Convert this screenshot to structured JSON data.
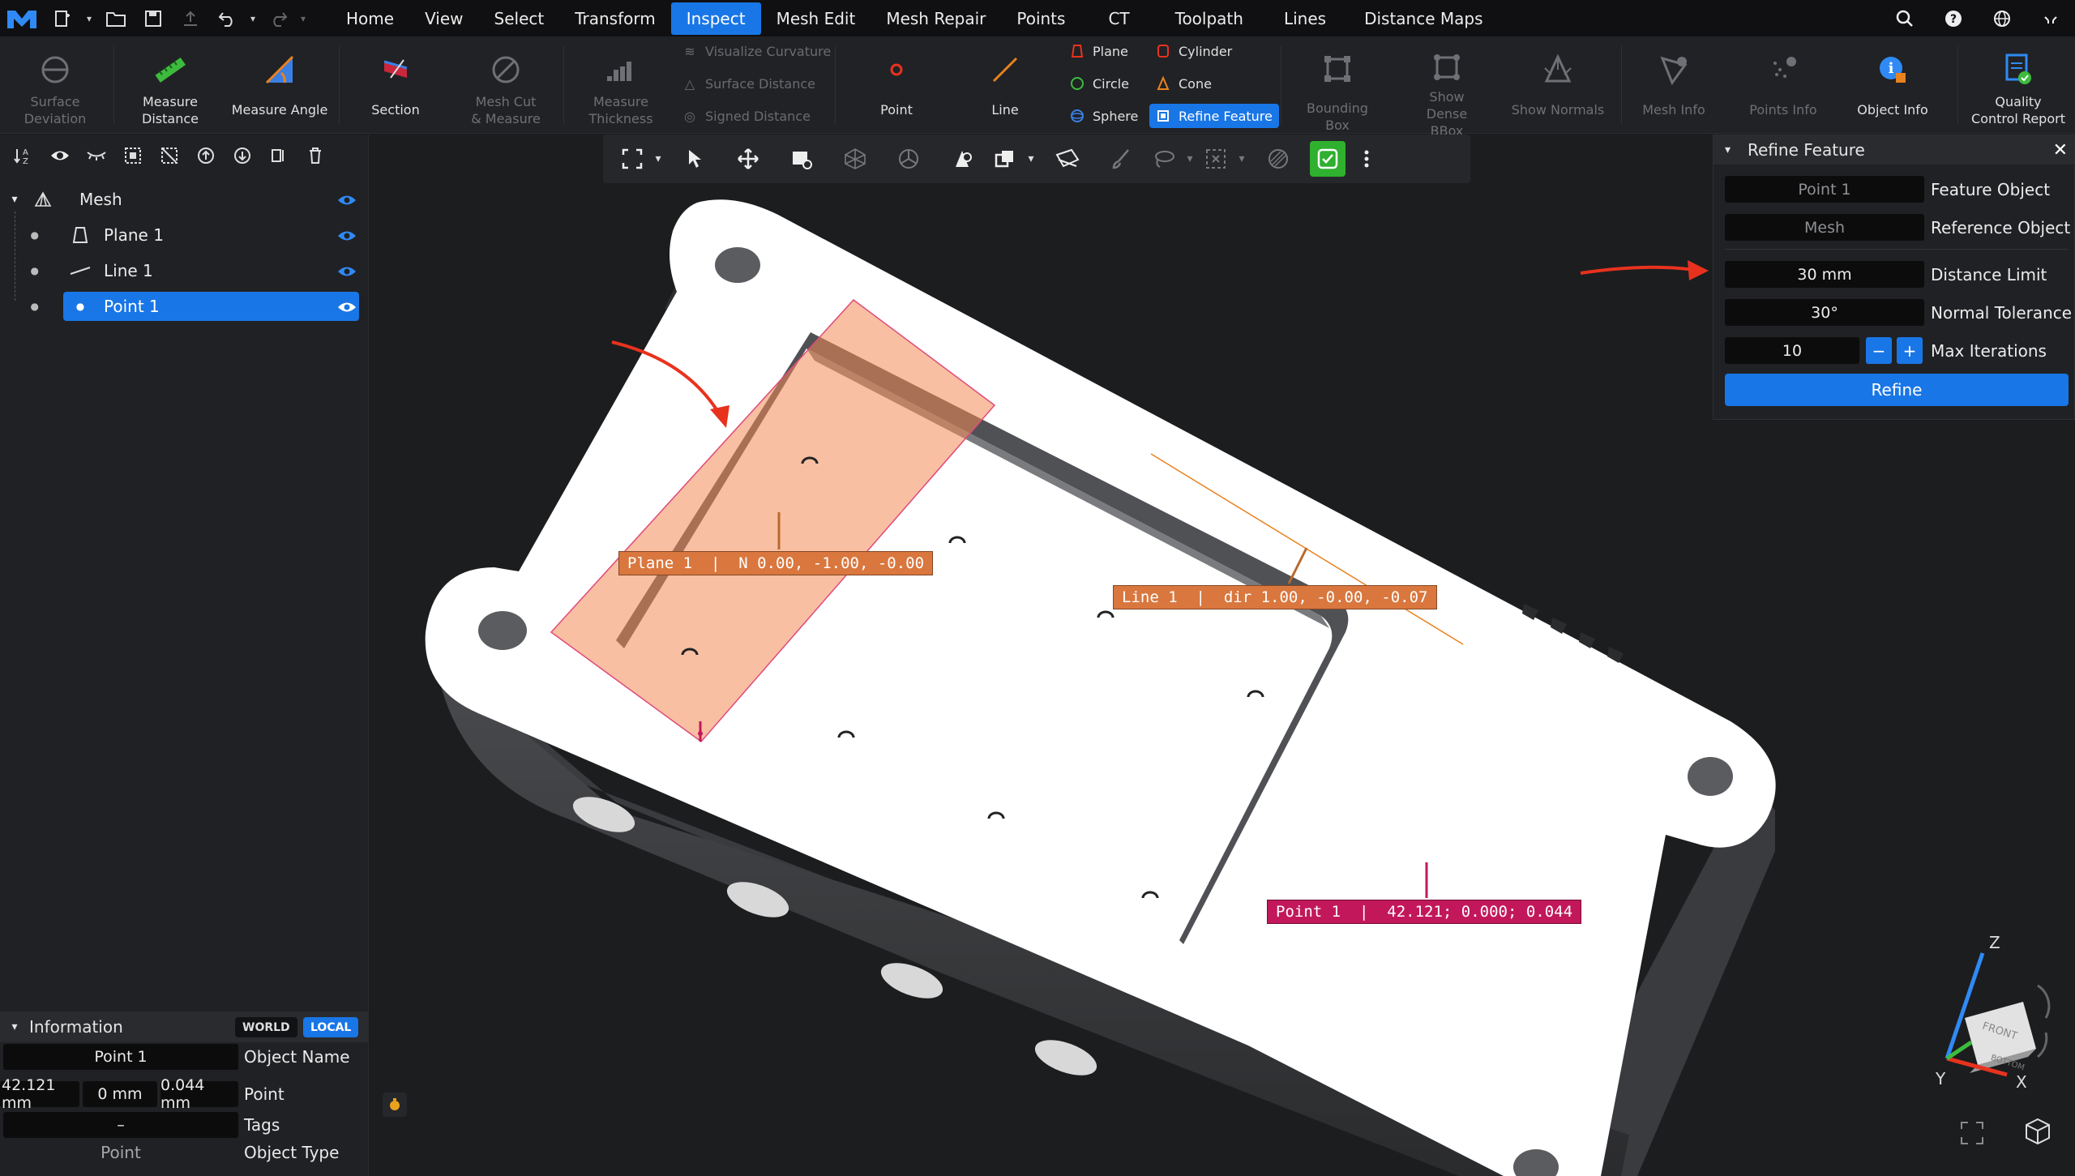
{
  "menubar": {
    "tabs": [
      "Home",
      "View",
      "Select",
      "Transform",
      "Inspect",
      "Mesh Edit",
      "Mesh Repair",
      "Points",
      "CT",
      "Toolpath",
      "Lines",
      "Distance Maps"
    ],
    "active_tab": "Inspect"
  },
  "ribbon": {
    "surface_deviation": "Surface Deviation",
    "measure_distance": "Measure Distance",
    "measure_angle": "Measure Angle",
    "section": "Section",
    "mesh_cut_measure": "Mesh Cut & Measure",
    "measure_thickness": "Measure Thickness",
    "visualize_curvature": "Visualize Curvature",
    "surface_distance": "Surface Distance",
    "signed_distance": "Signed Distance",
    "point": "Point",
    "line": "Line",
    "plane": "Plane",
    "circle": "Circle",
    "sphere": "Sphere",
    "cylinder": "Cylinder",
    "cone": "Cone",
    "refine_feature": "Refine Feature",
    "bounding_box": "Bounding Box",
    "show_dense_bbox": "Show Dense BBox",
    "show_normals": "Show Normals",
    "mesh_info": "Mesh Info",
    "points_info": "Points Info",
    "object_info": "Object Info",
    "quality_control_report": "Quality Control Report"
  },
  "tree": {
    "root": "Mesh",
    "items": [
      "Plane 1",
      "Line 1",
      "Point 1"
    ],
    "selected": "Point 1"
  },
  "information": {
    "title": "Information",
    "world": "WORLD",
    "local": "LOCAL",
    "object_name_value": "Point 1",
    "object_name_label": "Object Name",
    "point_x": "42.121 mm",
    "point_y": "0 mm",
    "point_z": "0.044 mm",
    "point_label": "Point",
    "tags_value": "–",
    "tags_label": "Tags",
    "object_type_value": "Point",
    "object_type_label": "Object Type"
  },
  "viewport_labels": {
    "plane": "Plane 1  |  N 0.00, -1.00, -0.00",
    "line": "Line 1  |  dir 1.00, -0.00, -0.07",
    "point": "Point 1  |  42.121; 0.000; 0.044"
  },
  "refine_panel": {
    "title": "Refine Feature",
    "feature_object_value": "Point 1",
    "feature_object_label": "Feature Object",
    "reference_object_value": "Mesh",
    "reference_object_label": "Reference Object",
    "distance_limit_value": "30 mm",
    "distance_limit_label": "Distance Limit",
    "normal_tolerance_value": "30°",
    "normal_tolerance_label": "Normal Tolerance",
    "max_iterations_value": "10",
    "max_iterations_label": "Max Iterations",
    "refine_button": "Refine"
  },
  "axis_gizmo": {
    "z": "Z",
    "y": "Y",
    "x": "X",
    "front": "FRONT",
    "bottom": "BOTTOM"
  },
  "colors": {
    "accent": "#1976e6",
    "plane_tag": "#d9773e",
    "line_tag": "#d9773e",
    "point_tag": "#c2185b",
    "annotation_arrow": "#e8321e"
  }
}
